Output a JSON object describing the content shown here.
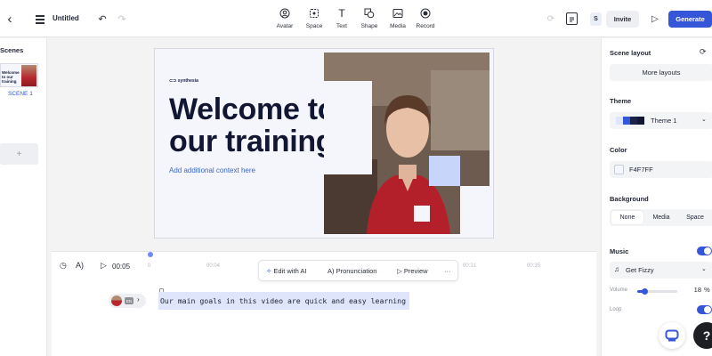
{
  "header": {
    "title": "Untitled",
    "tools": [
      {
        "label": "Avatar",
        "icon": "avatar-icon"
      },
      {
        "label": "Space",
        "icon": "space-icon"
      },
      {
        "label": "Text",
        "icon": "text-icon"
      },
      {
        "label": "Shape",
        "icon": "shape-icon"
      },
      {
        "label": "Media",
        "icon": "media-icon"
      },
      {
        "label": "Record",
        "icon": "record-icon"
      }
    ],
    "user_initial": "S",
    "invite_label": "Invite",
    "generate_label": "Generate",
    "accent_color": "#3556d8"
  },
  "scenes": {
    "title": "Scenes",
    "thumb_title": "Welcome to our training",
    "items": [
      {
        "label": "SCENE 1"
      }
    ],
    "add_label": "+"
  },
  "canvas": {
    "logo": "synthesia",
    "headline": "Welcome to our training",
    "subline": "Add additional context here",
    "background_color": "#F4F6FC"
  },
  "timeline": {
    "time": "00:05",
    "ticks": [
      "0",
      "00:04",
      "00:31",
      "00:35"
    ],
    "toolbar": {
      "edit_ai": "Edit with AI",
      "pronunciation": "Pronunciation",
      "preview": "Preview",
      "more": "···"
    },
    "speaker_lang": "EN",
    "script_text": "Our main goals in this video are quick and easy learning"
  },
  "right_panel": {
    "scene_layout_title": "Scene layout",
    "more_layouts": "More layouts",
    "theme_title": "Theme",
    "theme_name": "Theme 1",
    "theme_swatches": [
      "#dfe5fb",
      "#3556d8",
      "#1b2248",
      "#111633"
    ],
    "color_title": "Color",
    "color_value": "F4F7FF",
    "background_title": "Background",
    "background_options": [
      "None",
      "Media",
      "Space"
    ],
    "background_selected": "None",
    "music_title": "Music",
    "music_enabled": true,
    "track_name": "Get Fizzy",
    "volume_label": "Volume",
    "volume_value": "18",
    "volume_unit": "%",
    "volume_fraction": 0.18,
    "loop_label": "Loop",
    "loop_enabled": true
  }
}
